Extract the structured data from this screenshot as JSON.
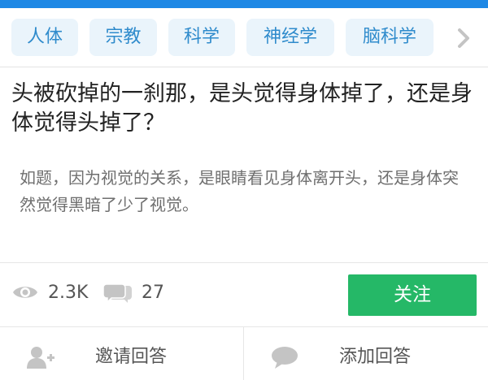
{
  "colors": {
    "top_bar": "#1e88e5",
    "tag_bg": "#eaf4fb",
    "tag_text": "#2f8bcc",
    "follow_button": "#25b867",
    "icon_gray": "#c4c4c4"
  },
  "tags": [
    {
      "label": "人体"
    },
    {
      "label": "宗教"
    },
    {
      "label": "科学"
    },
    {
      "label": "神经学"
    },
    {
      "label": "脑科学"
    }
  ],
  "tags_more_icon": "chevron-right-icon",
  "question": {
    "title": "头被砍掉的一刹那，是头觉得身体掉了，还是身体觉得头掉了？",
    "description": "如题，因为视觉的关系，是眼睛看见身体离开头，还是身体突然觉得黑暗了少了视觉。"
  },
  "stats": {
    "views": "2.3K",
    "views_icon": "eye-icon",
    "answers": "27",
    "answers_icon": "comments-icon"
  },
  "follow_label": "关注",
  "actions": [
    {
      "label": "邀请回答",
      "icon": "add-user-icon"
    },
    {
      "label": "添加回答",
      "icon": "comment-icon"
    }
  ]
}
